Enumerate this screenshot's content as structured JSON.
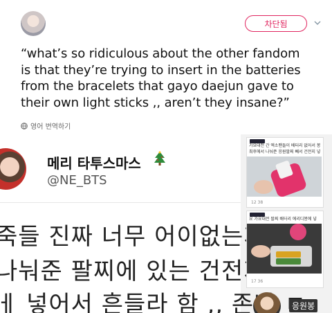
{
  "header": {
    "block_button": "차단됨"
  },
  "tweet": {
    "lines": [
      "“what’s so ridiculous about the other fandom",
      "is that they’re trying to insert in the batteries",
      "from the bracelets that gayo daejun gave to",
      "their own light sticks ,, aren’t they insane?”"
    ],
    "translate_label": "영어 번역하기"
  },
  "embedded": {
    "name": "메리 타투스마스",
    "handle": "@NE_BTS",
    "korean_lines": [
      "죽들 진짜 너무 어이없는게 ",
      "나눠준 팔찌에 있는 건전지",
      "ㅔ 넣어서 흔들라 함 ,, 존나 ㄷ"
    ]
  },
  "thumbnails": {
    "top_caption": "가요대전 간 엑소팬들이 배터리 없어서 봉",
    "top_caption2": "최후에서 나눠준 응원팔찌 빼서 건전지 넣",
    "bottom_caption": "요 가요대전 팔찌 배터리 에리디봉에 넣",
    "bottom_caption2": "",
    "stats1": "12 38",
    "stats2": "17 36",
    "bottom_label": "응원봉"
  }
}
